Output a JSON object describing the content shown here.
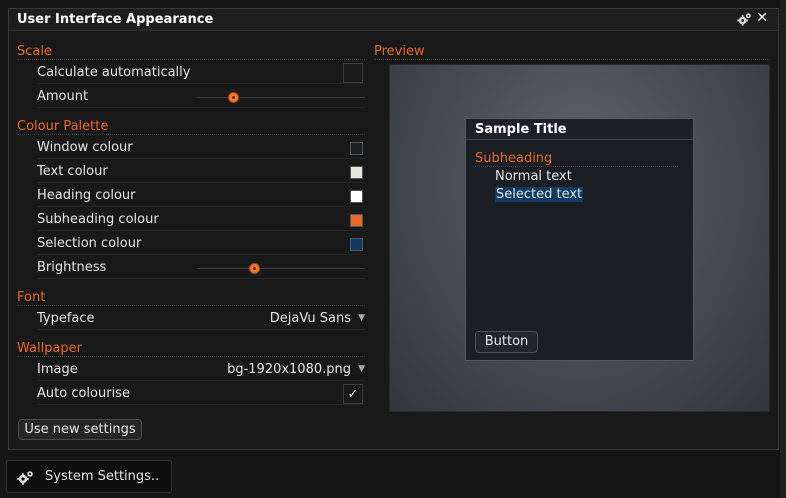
{
  "window": {
    "title": "User Interface Appearance",
    "gear_icon": "gear-icon",
    "close_glyph": "✕"
  },
  "scale": {
    "heading": "Scale",
    "calc_auto_label": "Calculate automatically",
    "calc_auto_checked": false,
    "amount_label": "Amount",
    "amount_level": 0.2
  },
  "palette": {
    "heading": "Colour Palette",
    "items": [
      {
        "label": "Window colour",
        "color": "#1b1e23"
      },
      {
        "label": "Text colour",
        "color": "#e6e6e0"
      },
      {
        "label": "Heading colour",
        "color": "#ffffff"
      },
      {
        "label": "Subheading colour",
        "color": "#e8692b"
      },
      {
        "label": "Selection colour",
        "color": "#0e3a64"
      }
    ],
    "brightness_label": "Brightness",
    "brightness_level": 0.33
  },
  "font": {
    "heading": "Font",
    "typeface_label": "Typeface",
    "typeface_value": "DejaVu Sans"
  },
  "wallpaper": {
    "heading": "Wallpaper",
    "image_label": "Image",
    "image_value": "bg-1920x1080.png",
    "auto_colourise_label": "Auto colourise",
    "auto_colourise_checked": true,
    "check_glyph": "✓"
  },
  "preview": {
    "heading": "Preview",
    "sample_title": "Sample Title",
    "subheading": "Subheading",
    "normal_text": "Normal text",
    "selected_text": "Selected text",
    "button_label": "Button"
  },
  "actions": {
    "use_new_settings": "Use new settings"
  },
  "taskbar": {
    "system_settings": "System Settings.."
  },
  "colors": {
    "accent": "#e8692b",
    "selection": "#0e3a64"
  }
}
